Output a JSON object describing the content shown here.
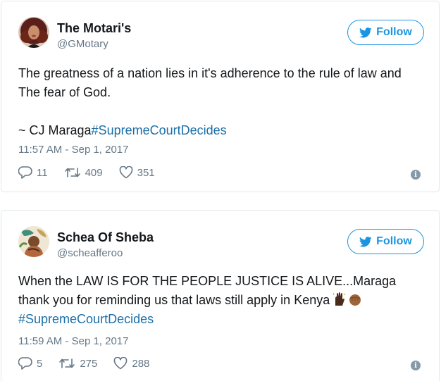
{
  "tweets": [
    {
      "name": "The Motari's",
      "handle": "@GMotary",
      "follow_label": "Follow",
      "text_line1": "The greatness of a nation lies in it's adherence to the rule of law and The fear of God.",
      "text_signature": "~ CJ Maraga",
      "hashtag": "#SupremeCourtDecides",
      "timestamp": "11:57 AM - Sep 1, 2017",
      "replies": "11",
      "retweets": "409",
      "likes": "351",
      "avatar_icon": "profile-photo-woman-curly-hair"
    },
    {
      "name": "Schea Of Sheba",
      "handle": "@scheafferoo",
      "follow_label": "Follow",
      "text_line1": "When the LAW IS FOR THE PEOPLE JUSTICE IS ALIVE...Maraga thank you for reminding us that laws still apply in Kenya",
      "hashtag": "#SupremeCourtDecides",
      "emoji": "raised-hands-and-raised-fist-emoji",
      "timestamp": "11:59 AM - Sep 1, 2017",
      "replies": "5",
      "retweets": "275",
      "likes": "288",
      "avatar_icon": "profile-photo-woman-painting"
    }
  ],
  "colors": {
    "twitter_blue": "#1b95e0",
    "hashtag": "#1b6fa8",
    "muted": "#657786",
    "border": "#e1e8ed"
  }
}
